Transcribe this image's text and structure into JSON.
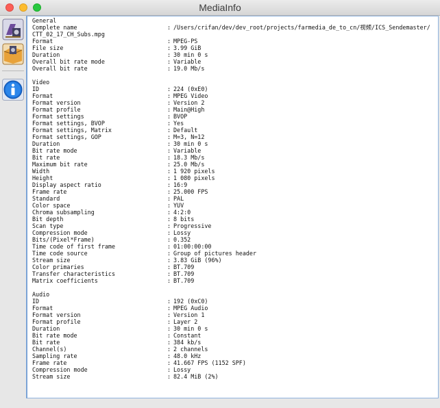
{
  "window": {
    "title": "MediaInfo"
  },
  "sidebar": {
    "buttons": [
      {
        "name": "sheet-view-icon"
      },
      {
        "name": "export-icon"
      },
      {
        "name": "about-info-icon"
      }
    ]
  },
  "sections": [
    {
      "title": "General",
      "rows": [
        {
          "label": "Complete name",
          "value": "/Users/crifan/dev/dev_root/projects/farmedia_de_to_cn/视频/ICS_Sendemaster/",
          "cont": "CTT_02_17_CH_Subs.mpg"
        },
        {
          "label": "Format",
          "value": "MPEG-PS"
        },
        {
          "label": "File size",
          "value": "3.99 GiB"
        },
        {
          "label": "Duration",
          "value": "30 min 0 s"
        },
        {
          "label": "Overall bit rate mode",
          "value": "Variable"
        },
        {
          "label": "Overall bit rate",
          "value": "19.0 Mb/s"
        }
      ]
    },
    {
      "title": "Video",
      "rows": [
        {
          "label": "ID",
          "value": "224 (0xE0)"
        },
        {
          "label": "Format",
          "value": "MPEG Video"
        },
        {
          "label": "Format version",
          "value": "Version 2"
        },
        {
          "label": "Format profile",
          "value": "Main@High"
        },
        {
          "label": "Format settings",
          "value": "BVOP"
        },
        {
          "label": "Format settings, BVOP",
          "value": "Yes"
        },
        {
          "label": "Format settings, Matrix",
          "value": "Default"
        },
        {
          "label": "Format settings, GOP",
          "value": "M=3, N=12"
        },
        {
          "label": "Duration",
          "value": "30 min 0 s"
        },
        {
          "label": "Bit rate mode",
          "value": "Variable"
        },
        {
          "label": "Bit rate",
          "value": "18.3 Mb/s"
        },
        {
          "label": "Maximum bit rate",
          "value": "25.0 Mb/s"
        },
        {
          "label": "Width",
          "value": "1 920 pixels"
        },
        {
          "label": "Height",
          "value": "1 080 pixels"
        },
        {
          "label": "Display aspect ratio",
          "value": "16:9"
        },
        {
          "label": "Frame rate",
          "value": "25.000 FPS"
        },
        {
          "label": "Standard",
          "value": "PAL"
        },
        {
          "label": "Color space",
          "value": "YUV"
        },
        {
          "label": "Chroma subsampling",
          "value": "4:2:0"
        },
        {
          "label": "Bit depth",
          "value": "8 bits"
        },
        {
          "label": "Scan type",
          "value": "Progressive"
        },
        {
          "label": "Compression mode",
          "value": "Lossy"
        },
        {
          "label": "Bits/(Pixel*Frame)",
          "value": "0.352"
        },
        {
          "label": "Time code of first frame",
          "value": "01:00:00:00"
        },
        {
          "label": "Time code source",
          "value": "Group of pictures header"
        },
        {
          "label": "Stream size",
          "value": "3.83 GiB (96%)"
        },
        {
          "label": "Color primaries",
          "value": "BT.709"
        },
        {
          "label": "Transfer characteristics",
          "value": "BT.709"
        },
        {
          "label": "Matrix coefficients",
          "value": "BT.709"
        }
      ]
    },
    {
      "title": "Audio",
      "rows": [
        {
          "label": "ID",
          "value": "192 (0xC0)"
        },
        {
          "label": "Format",
          "value": "MPEG Audio"
        },
        {
          "label": "Format version",
          "value": "Version 1"
        },
        {
          "label": "Format profile",
          "value": "Layer 2"
        },
        {
          "label": "Duration",
          "value": "30 min 0 s"
        },
        {
          "label": "Bit rate mode",
          "value": "Constant"
        },
        {
          "label": "Bit rate",
          "value": "384 kb/s"
        },
        {
          "label": "Channel(s)",
          "value": "2 channels"
        },
        {
          "label": "Sampling rate",
          "value": "48.0 kHz"
        },
        {
          "label": "Frame rate",
          "value": "41.667 FPS (1152 SPF)"
        },
        {
          "label": "Compression mode",
          "value": "Lossy"
        },
        {
          "label": "Stream size",
          "value": "82.4 MiB (2%)"
        }
      ]
    }
  ]
}
